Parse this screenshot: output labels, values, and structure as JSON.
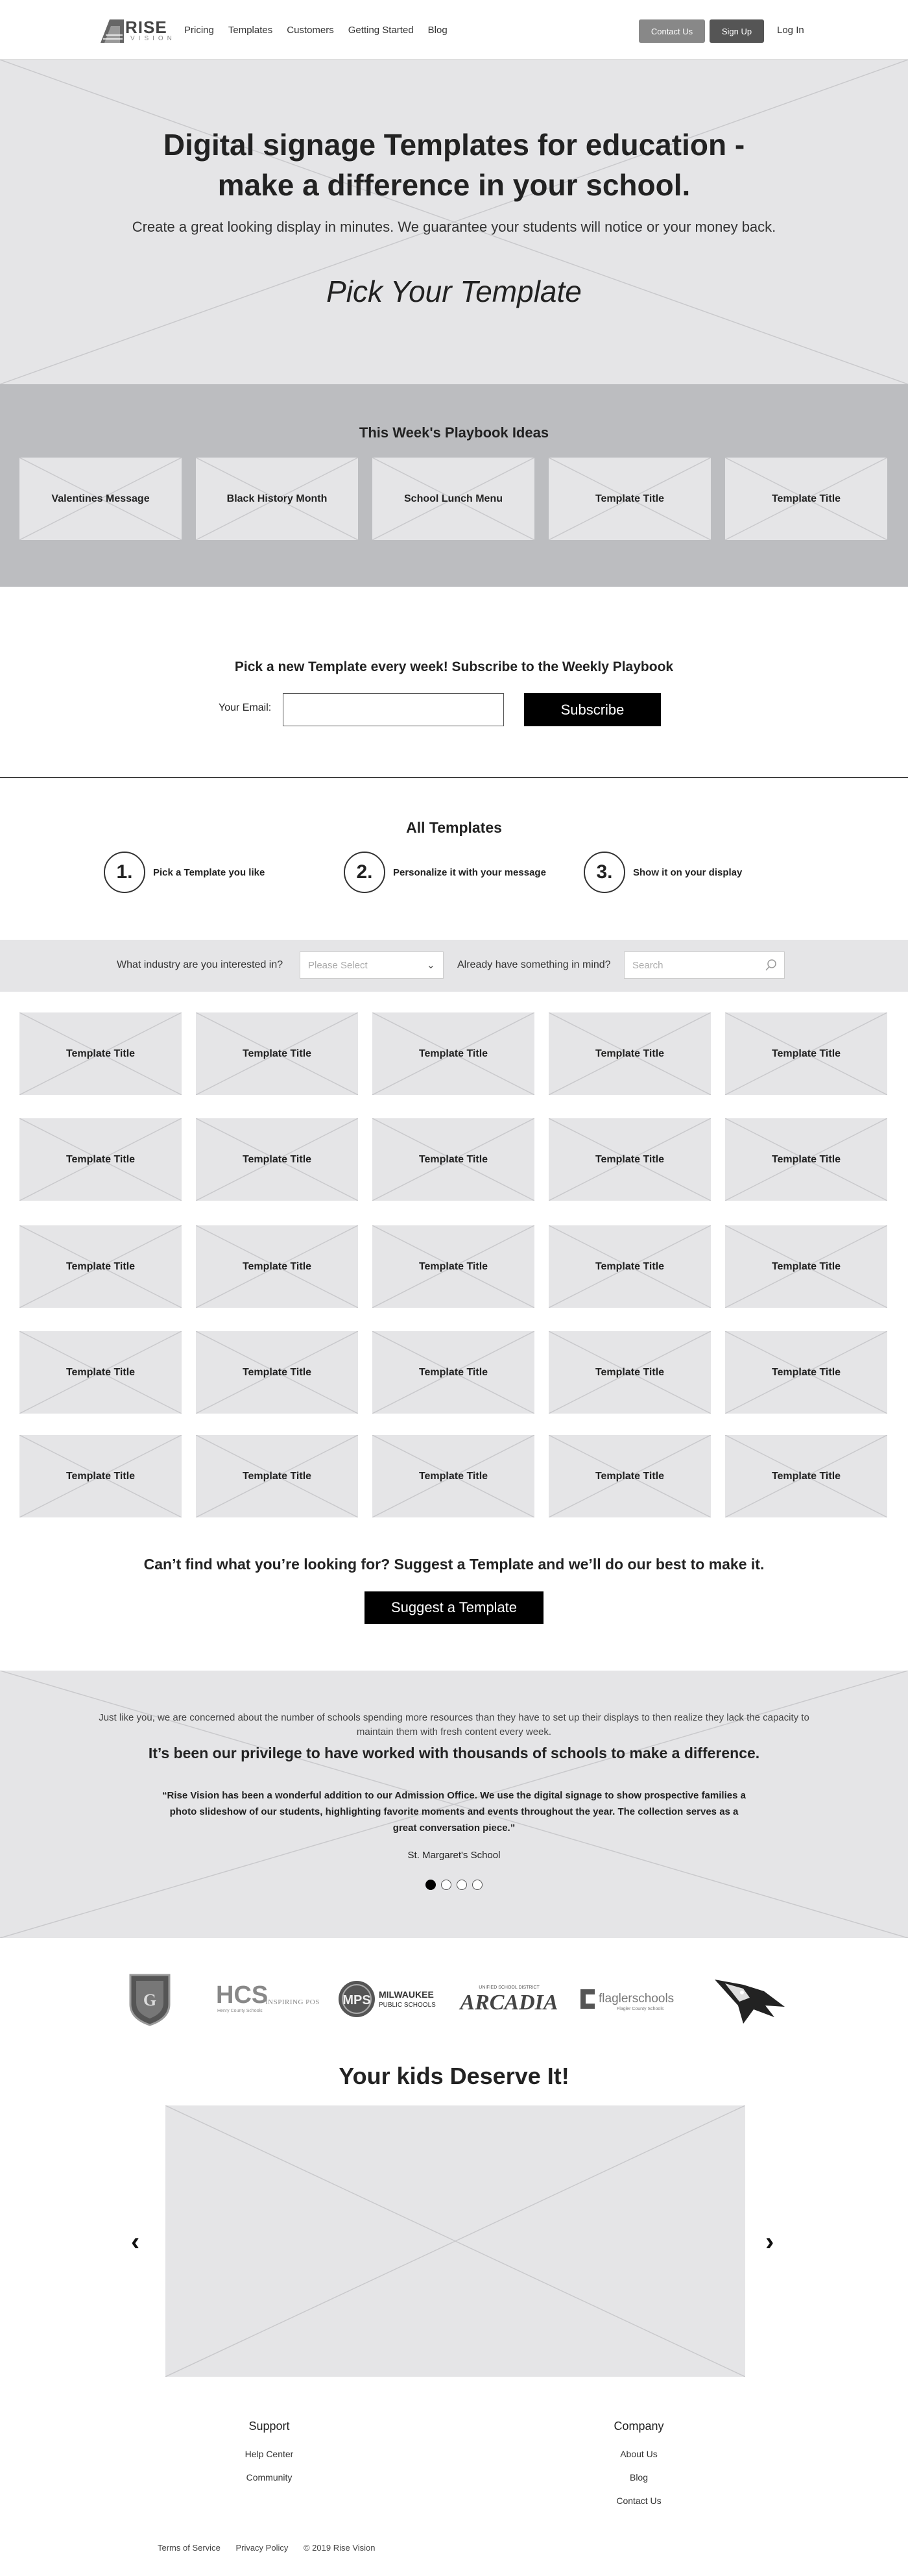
{
  "header": {
    "logo_rise": "RISE",
    "logo_vision": "VISION",
    "nav": [
      "Pricing",
      "Templates",
      "Customers",
      "Getting Started",
      "Blog"
    ],
    "contact_label": "Contact Us",
    "signup_label": "Sign Up",
    "login_label": "Log In"
  },
  "hero": {
    "title_line1": "Digital signage Templates for education -",
    "title_line2": "make a difference in your school.",
    "subtitle": "Create a great looking display in minutes. We guarantee your students will notice or your money back.",
    "pick": "Pick Your Template"
  },
  "playbook": {
    "title": "This Week's Playbook Ideas",
    "cards": [
      "Valentines Message",
      "Black History Month",
      "School Lunch Menu",
      "Template Title",
      "Template Title"
    ]
  },
  "subscribe": {
    "title": "Pick a new Template every week! Subscribe to the Weekly Playbook",
    "email_label": "Your Email:",
    "button_label": "Subscribe"
  },
  "all_templates": {
    "title": "All Templates",
    "steps": [
      {
        "num": "1.",
        "text": "Pick a Template you like"
      },
      {
        "num": "2.",
        "text": "Personalize it with your message"
      },
      {
        "num": "3.",
        "text": "Show it on your display"
      }
    ]
  },
  "filter": {
    "industry_label": "What industry are you interested in?",
    "industry_placeholder": "Please Select",
    "search_label": "Already have something in mind?",
    "search_placeholder": "Search"
  },
  "templates": {
    "title": "Template Title",
    "count_rows": 5,
    "count_cols": 5
  },
  "suggest": {
    "title": "Can’t find what you’re looking for? Suggest a Template and we’ll do our best to make it.",
    "button_label": "Suggest a Template"
  },
  "testimonial": {
    "intro": "Just like you, we are concerned about the number of schools spending more resources than they have to set up their displays to then realize they lack the capacity to maintain them with fresh content every week.",
    "heading": "It’s been our privilege to have worked with thousands of schools to make a difference.",
    "quote": "“Rise Vision has been a wonderful addition to our Admission Office. We use the digital signage to show prospective families a photo slideshow of our students, highlighting favorite moments and events throughout the year. The collection serves as a great conversation piece.”",
    "author": "St. Margaret's School",
    "slides": 4,
    "active_slide": 1
  },
  "logos": {
    "hcs": "HCS",
    "hcs_tag": "INSPIRING POSSIBILITIES",
    "hcs_sub": "Henry County Schools",
    "mps": "MPS",
    "mps_name1": "MILWAUKEE",
    "mps_name2": "PUBLIC SCHOOLS",
    "arcadia_top": "UNIFIED SCHOOL DISTRICT",
    "arcadia": "ARCADIA",
    "flagler": "flaglerschools",
    "flagler_sub": "Flagler County Schools"
  },
  "kids": {
    "title": "Your kids Deserve It!"
  },
  "footer": {
    "support_title": "Support",
    "support_links": [
      "Help Center",
      "Community"
    ],
    "company_title": "Company",
    "company_links": [
      "About Us",
      "Blog",
      "Contact Us"
    ],
    "terms": "Terms of Service",
    "privacy": "Privacy Policy",
    "copyright": "© 2019 Rise Vision"
  },
  "colors": {
    "placeholder": "#e5e5e7",
    "playbook_bg": "#bcbdc0",
    "accent_dark": "#000000"
  }
}
